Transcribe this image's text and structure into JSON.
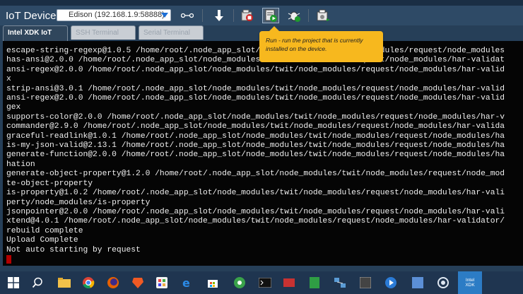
{
  "window": {
    "toolbar": {
      "iot_label": "IoT Device:",
      "device_value": "Edison (192.168.1.9:58888)"
    },
    "tabs": [
      {
        "label": "Intel XDK IoT",
        "active": true
      },
      {
        "label": "SSH Terminal",
        "active": false
      },
      {
        "label": "Serial Terminal",
        "active": false
      }
    ],
    "terminal": {
      "lines": [
        "escape-string-regexp@1.0.5 /home/root/.node_app_slot/node_modules/twit/node_modules/request/node_modules",
        "has-ansi@2.0.0 /home/root/.node_app_slot/node_modules/twit/node_modules/request/node_modules/har-validat",
        "ansi-regex@2.0.0 /home/root/.node_app_slot/node_modules/twit/node_modules/request/node_modules/har-valid",
        "x",
        "strip-ansi@3.0.1 /home/root/.node_app_slot/node_modules/twit/node_modules/request/node_modules/har-valid",
        "ansi-regex@2.0.0 /home/root/.node_app_slot/node_modules/twit/node_modules/request/node_modules/har-valid",
        "gex",
        "supports-color@2.0.0 /home/root/.node_app_slot/node_modules/twit/node_modules/request/node_modules/har-v",
        "commander@2.9.0 /home/root/.node_app_slot/node_modules/twit/node_modules/request/node_modules/har-valida",
        "graceful-readlink@1.0.1 /home/root/.node_app_slot/node_modules/twit/node_modules/request/node_modules/ha",
        "is-my-json-valid@2.13.1 /home/root/.node_app_slot/node_modules/twit/node_modules/request/node_modules/ha",
        "generate-function@2.0.0 /home/root/.node_app_slot/node_modules/twit/node_modules/request/node_modules/ha",
        "hation",
        "generate-object-property@1.2.0 /home/root/.node_app_slot/node_modules/twit/node_modules/request/node_mod",
        "te-object-property",
        "is-property@1.0.2 /home/root/.node_app_slot/node_modules/twit/node_modules/request/node_modules/har-vali",
        "perty/node_modules/is-property",
        "jsonpointer@2.0.0 /home/root/.node_app_slot/node_modules/twit/node_modules/request/node_modules/har-vali",
        "xtend@4.0.1 /home/root/.node_app_slot/node_modules/twit/node_modules/request/node_modules/har-validator/",
        "rebuild complete",
        "Upload Complete",
        "Not auto starting by request"
      ]
    },
    "tooltip": {
      "run_word": "Run",
      "description": " - run the project that is currently installed on the device."
    }
  },
  "taskbar": {
    "xdk_label_line1": "Intel",
    "xdk_label_line2": "XDK",
    "colors": {
      "taskbar": "#1f3550",
      "active": "#2c7cc5"
    }
  },
  "colors": {
    "toolbar": "#2e4a66",
    "terminal_bg": "#050505",
    "terminal_fg": "#f0f0f0",
    "tooltip_bg": "#f7b81e",
    "cursor": "#b30000"
  }
}
